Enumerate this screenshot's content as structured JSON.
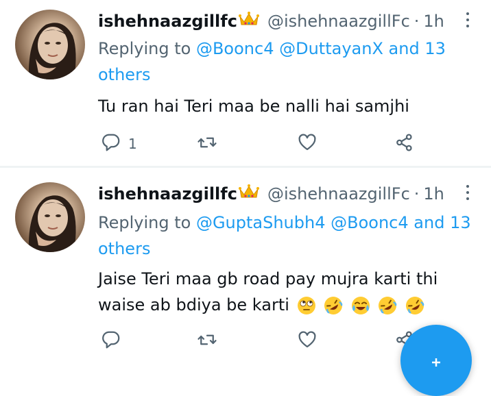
{
  "tweets": [
    {
      "display_name": "ishehnaazgillfc",
      "name_emoji": "crown",
      "handle": "@ishehnaazgillFc",
      "separator": "·",
      "time": "1h",
      "reply_prefix": "Replying to",
      "mentions": [
        "@Boonc4",
        "@DuttayanX"
      ],
      "others": "and 13 others",
      "text": "Tu ran hai Teri maa be nalli hai samjhi",
      "text_emojis": [],
      "reply_count": "1"
    },
    {
      "display_name": "ishehnaazgillfc",
      "name_emoji": "crown",
      "handle": "@ishehnaazgillFc",
      "separator": "·",
      "time": "1h",
      "reply_prefix": "Replying to",
      "mentions": [
        "@GuptaShubh4",
        "@Boonc4"
      ],
      "others": "and 13 others",
      "text_line1": "Jaise Teri maa gb road pay mujra karti thi",
      "text_line2": "waise ab bdiya be karti",
      "text_emojis": [
        "face-with-rolling-eyes",
        "rolling-on-the-floor-laughing",
        "face-with-tears-of-joy",
        "rolling-on-the-floor-laughing",
        "rolling-on-the-floor-laughing"
      ],
      "reply_count": ""
    }
  ],
  "icons": [
    "reply-icon",
    "retweet-icon",
    "like-icon",
    "share-icon",
    "more-icon",
    "compose-icon"
  ],
  "colors": {
    "accent": "#1d9bf0",
    "text": "#0f1419",
    "secondary": "#536471",
    "divider": "#eff3f4"
  }
}
